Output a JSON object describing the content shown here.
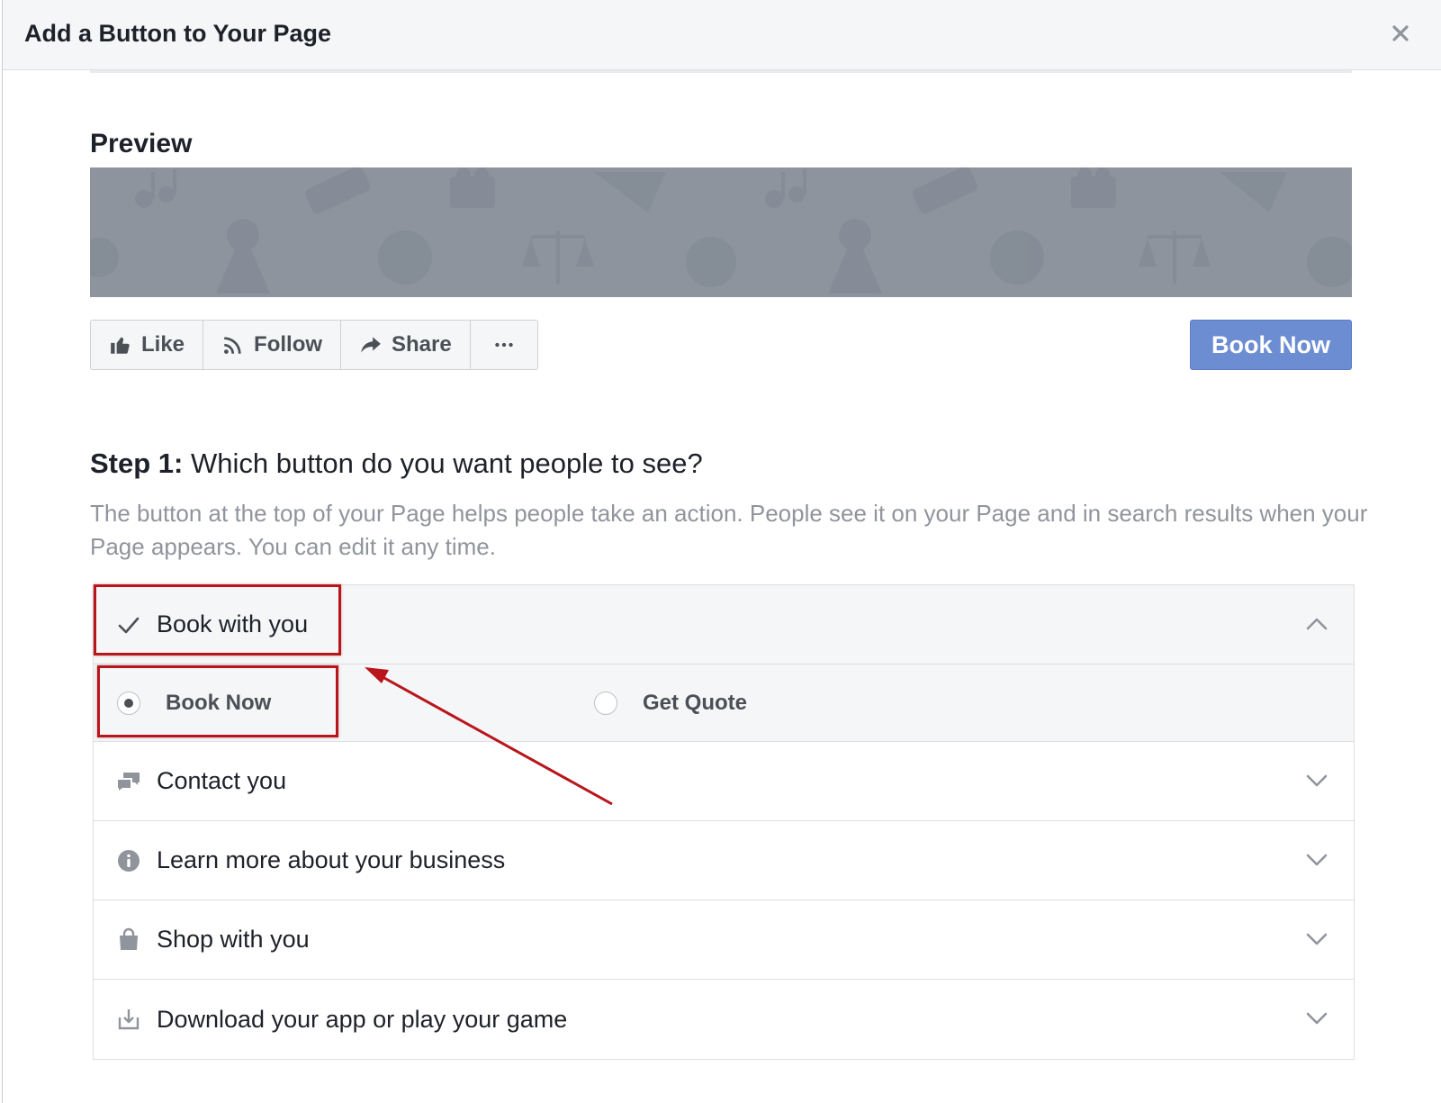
{
  "dialog": {
    "title": "Add a Button to Your Page",
    "close_icon": "close-icon"
  },
  "preview": {
    "title": "Preview",
    "actions": [
      {
        "label": "Like",
        "icon": "thumbs-up-icon"
      },
      {
        "label": "Follow",
        "icon": "rss-icon"
      },
      {
        "label": "Share",
        "icon": "share-arrow-icon"
      },
      {
        "label": "",
        "icon": "more-dots-icon"
      }
    ],
    "cta_label": "Book Now",
    "cta_color": "#6d8dd3"
  },
  "step1": {
    "label": "Step 1:",
    "question": " Which button do you want people to see?",
    "description": "The button at the top of your Page helps people take an action. People see it on your Page and in search results when your Page appears. You can edit it any time."
  },
  "categories": [
    {
      "label": "Book with you",
      "icon": "checkmark-icon",
      "expanded": true
    },
    {
      "label": "Contact you",
      "icon": "chat-bubbles-icon",
      "expanded": false
    },
    {
      "label": "Learn more about your business",
      "icon": "info-icon",
      "expanded": false
    },
    {
      "label": "Shop with you",
      "icon": "shopping-bag-icon",
      "expanded": false
    },
    {
      "label": "Download your app or play your game",
      "icon": "download-icon",
      "expanded": false
    }
  ],
  "options": [
    {
      "label": "Book Now",
      "selected": true
    },
    {
      "label": "Get Quote",
      "selected": false
    }
  ],
  "annotation_color": "#b8161c"
}
